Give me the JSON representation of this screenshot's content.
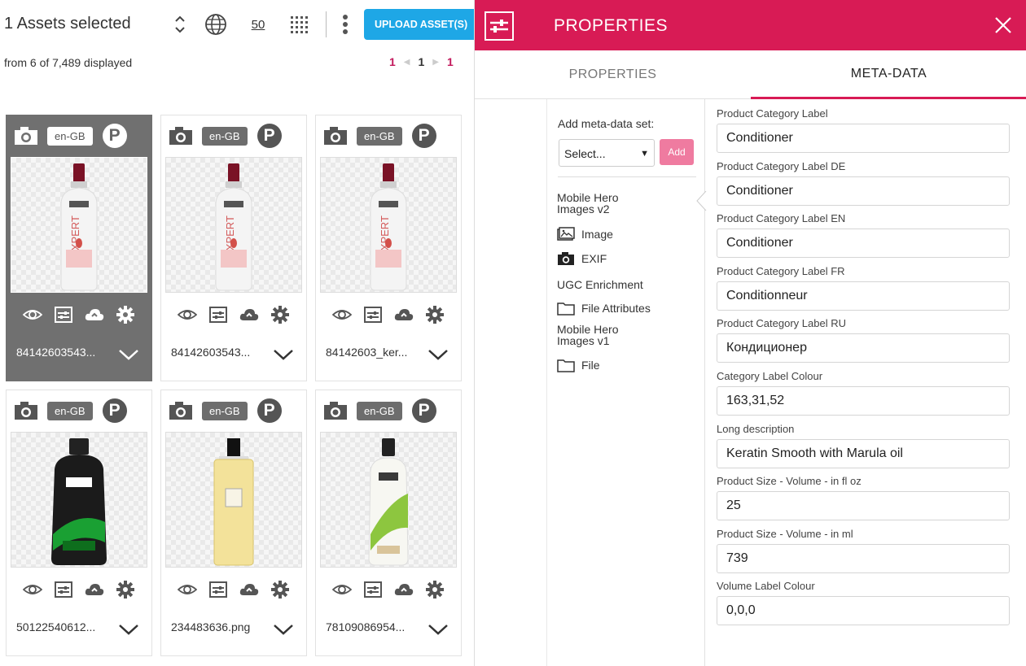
{
  "toolbar": {
    "title": "1 Assets selected",
    "page_size": "50",
    "upload_label": "UPLOAD ASSET(S)",
    "displayed": "from 6 of 7,489 displayed",
    "pager": {
      "first": "1",
      "current": "1",
      "last": "1"
    }
  },
  "assets": [
    {
      "locale": "en-GB",
      "badge": "P",
      "filename": "84142603543...",
      "selected": true,
      "product": "tresemme-expert"
    },
    {
      "locale": "en-GB",
      "badge": "P",
      "filename": "84142603543...",
      "selected": false,
      "product": "tresemme-expert"
    },
    {
      "locale": "en-GB",
      "badge": "P",
      "filename": "84142603_ker...",
      "selected": false,
      "product": "tresemme-expert"
    },
    {
      "locale": "en-GB",
      "badge": "P",
      "filename": "50122540612...",
      "selected": false,
      "product": "tresemme-black"
    },
    {
      "locale": "en-GB",
      "badge": "P",
      "filename": "234483636.png",
      "selected": false,
      "product": "jo-malone-oil"
    },
    {
      "locale": "en-GB",
      "badge": "P",
      "filename": "78109086954...",
      "selected": false,
      "product": "tresemme-naturals"
    }
  ],
  "panel": {
    "title": "PROPERTIES",
    "tabs": {
      "properties": "PROPERTIES",
      "metadata": "META-DATA"
    },
    "accent_color": "#d81b55"
  },
  "sidebar": {
    "add_label": "Add meta-data set:",
    "select_value": "Select...",
    "add_button": "Add",
    "items": [
      {
        "label": "Mobile Hero Images v2",
        "icon": "none"
      },
      {
        "label": "Image",
        "icon": "image-icon"
      },
      {
        "label": "EXIF",
        "icon": "camera-icon"
      },
      {
        "label": "UGC Enrichment",
        "icon": "none"
      },
      {
        "label": "File Attributes",
        "icon": "folder-icon"
      },
      {
        "label": "Mobile Hero Images v1",
        "icon": "none"
      },
      {
        "label": "File",
        "icon": "folder-icon"
      }
    ]
  },
  "fields": [
    {
      "label": "Product Category Label",
      "value": "Conditioner"
    },
    {
      "label": "Product Category Label DE",
      "value": "Conditioner"
    },
    {
      "label": "Product Category Label EN",
      "value": "Conditioner"
    },
    {
      "label": "Product Category Label FR",
      "value": "Conditionneur"
    },
    {
      "label": "Product Category Label RU",
      "value": "Кондиционер"
    },
    {
      "label": "Category Label Colour",
      "value": "163,31,52"
    },
    {
      "label": "Long description",
      "value": "Keratin Smooth with Marula oil"
    },
    {
      "label": "Product Size - Volume - in fl oz",
      "value": "25"
    },
    {
      "label": "Product Size - Volume - in ml",
      "value": "739"
    },
    {
      "label": "Volume Label Colour",
      "value": "0,0,0"
    }
  ]
}
